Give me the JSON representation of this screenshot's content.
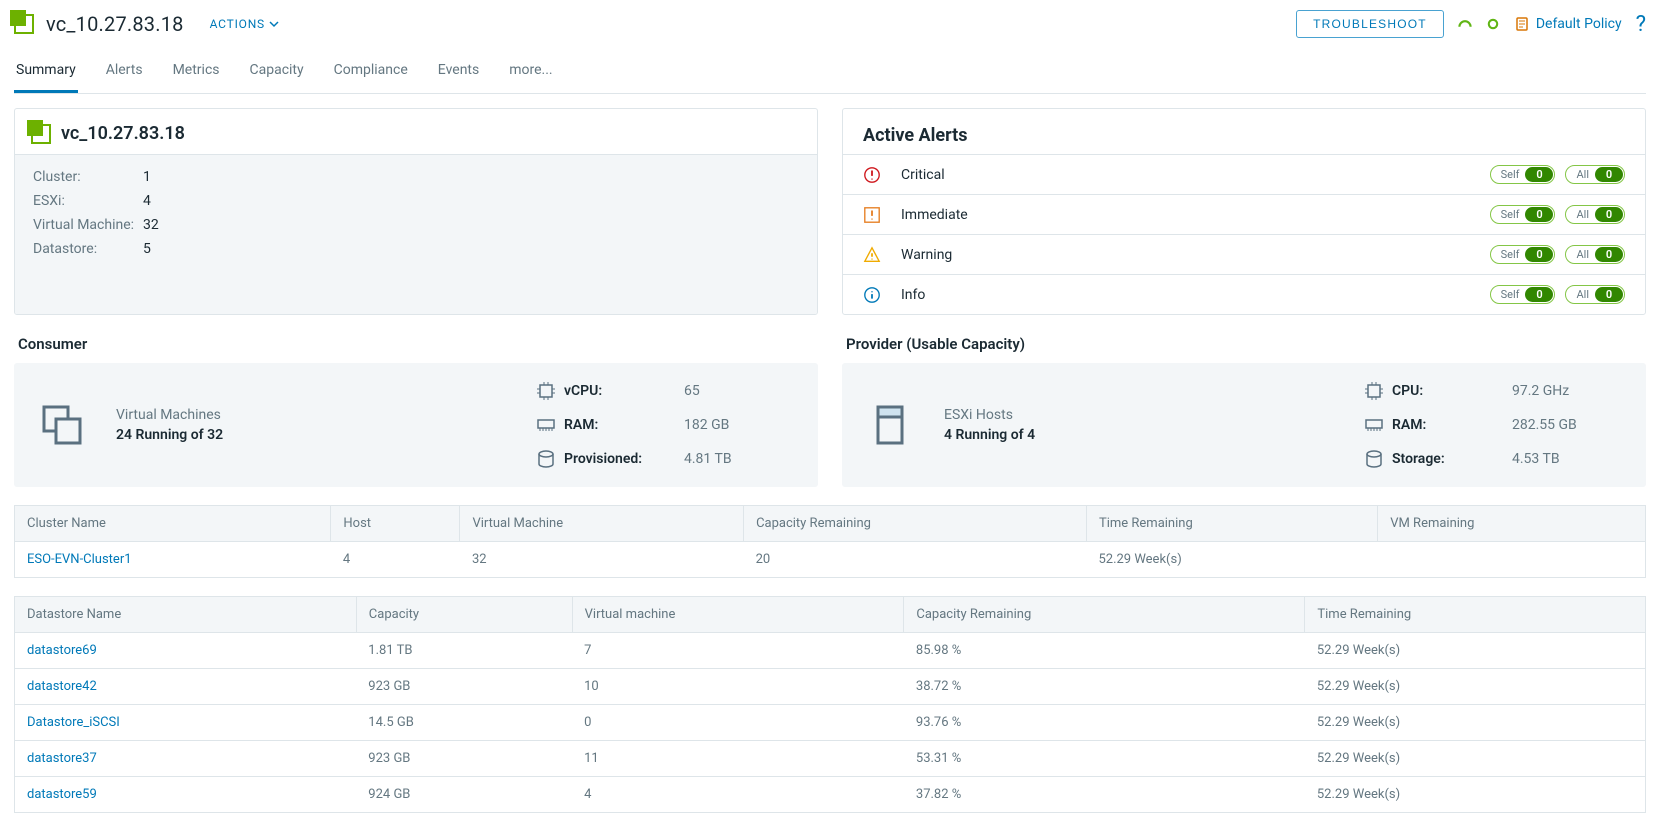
{
  "header": {
    "title": "vc_10.27.83.18",
    "actions_label": "ACTIONS",
    "troubleshoot_label": "TROUBLESHOOT",
    "policy_label": "Default Policy"
  },
  "tabs": [
    "Summary",
    "Alerts",
    "Metrics",
    "Capacity",
    "Compliance",
    "Events",
    "more..."
  ],
  "overview": {
    "title": "vc_10.27.83.18",
    "items": [
      {
        "k": "Cluster:",
        "v": "1"
      },
      {
        "k": "ESXi:",
        "v": "4"
      },
      {
        "k": "Virtual Machine:",
        "v": "32"
      },
      {
        "k": "Datastore:",
        "v": "5"
      }
    ]
  },
  "active_alerts": {
    "title": "Active Alerts",
    "levels": [
      {
        "name": "Critical",
        "self_label": "Self",
        "self_count": "0",
        "all_label": "All",
        "all_count": "0"
      },
      {
        "name": "Immediate",
        "self_label": "Self",
        "self_count": "0",
        "all_label": "All",
        "all_count": "0"
      },
      {
        "name": "Warning",
        "self_label": "Self",
        "self_count": "0",
        "all_label": "All",
        "all_count": "0"
      },
      {
        "name": "Info",
        "self_label": "Self",
        "self_count": "0",
        "all_label": "All",
        "all_count": "0"
      }
    ]
  },
  "consumer": {
    "section_title": "Consumer",
    "lead_title": "Virtual Machines",
    "lead_sub": "24 Running of 32",
    "stats": [
      {
        "label": "vCPU:",
        "value": "65"
      },
      {
        "label": "RAM:",
        "value": "182 GB"
      },
      {
        "label": "Provisioned:",
        "value": "4.81 TB"
      }
    ]
  },
  "provider": {
    "section_title": "Provider (Usable Capacity)",
    "lead_title": "ESXi Hosts",
    "lead_sub": "4 Running of 4",
    "stats": [
      {
        "label": "CPU:",
        "value": "97.2 GHz"
      },
      {
        "label": "RAM:",
        "value": "282.55 GB"
      },
      {
        "label": "Storage:",
        "value": "4.53 TB"
      }
    ]
  },
  "clusters_table": {
    "headers": [
      "Cluster Name",
      "Host",
      "Virtual Machine",
      "Capacity Remaining",
      "Time Remaining",
      "VM Remaining"
    ],
    "rows": [
      [
        "ESO-EVN-Cluster1",
        "4",
        "32",
        "20",
        "52.29 Week(s)",
        ""
      ]
    ]
  },
  "datastores_table": {
    "headers": [
      "Datastore Name",
      "Capacity",
      "Virtual machine",
      "Capacity Remaining",
      "Time Remaining"
    ],
    "rows": [
      [
        "datastore69",
        "1.81 TB",
        "7",
        "85.98 %",
        "52.29 Week(s)"
      ],
      [
        "datastore42",
        "923 GB",
        "10",
        "38.72 %",
        "52.29 Week(s)"
      ],
      [
        "Datastore_iSCSI",
        "14.5 GB",
        "0",
        "93.76 %",
        "52.29 Week(s)"
      ],
      [
        "datastore37",
        "923 GB",
        "11",
        "53.31 %",
        "52.29 Week(s)"
      ],
      [
        "datastore59",
        "924 GB",
        "4",
        "37.82 %",
        "52.29 Week(s)"
      ]
    ]
  }
}
